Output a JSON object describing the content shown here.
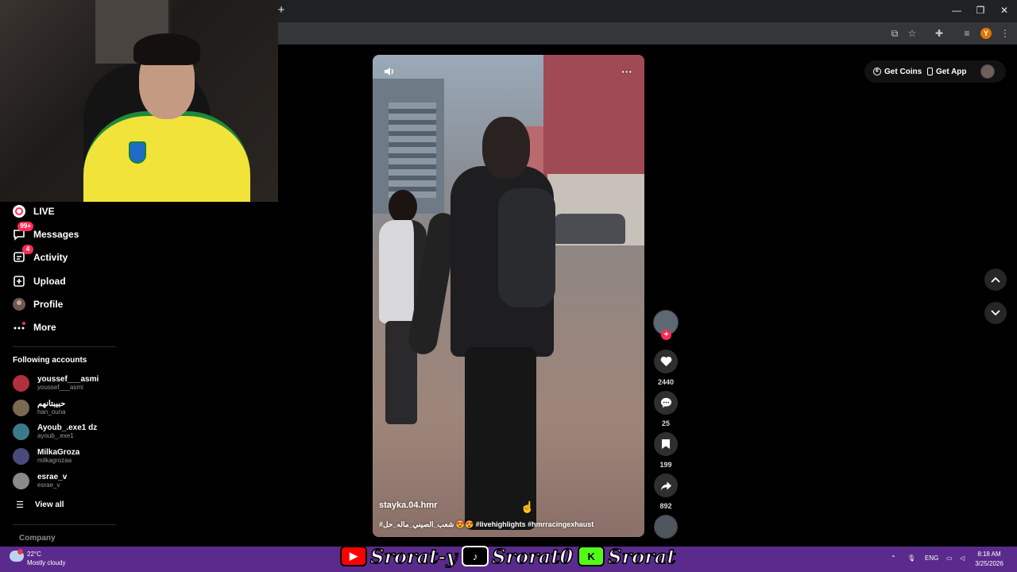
{
  "nav": {
    "live": "LIVE",
    "messages": "Messages",
    "messages_badge": "99+",
    "activity": "Activity",
    "activity_badge": "4",
    "upload": "Upload",
    "profile": "Profile",
    "more": "More"
  },
  "following": {
    "title": "Following accounts",
    "accounts": [
      {
        "name": "youssef___asmi",
        "handle": "youssef___asmi",
        "color": "#b03040"
      },
      {
        "name": "حبيبتانهم",
        "handle": "han_ouna",
        "color": "#7a6a50"
      },
      {
        "name": "Ayoub_.exe1 dz",
        "handle": "ayoub_.exe1",
        "color": "#3a7a8a"
      },
      {
        "name": "MilkaGroza",
        "handle": "milkagrozaa",
        "color": "#4a4a7a"
      },
      {
        "name": "esrae_v",
        "handle": "esrae_v",
        "color": "#8a8a8a"
      }
    ],
    "view_all": "View all"
  },
  "company": "Company",
  "top": {
    "get_coins": "Get Coins",
    "get_app": "Get App"
  },
  "video": {
    "username": "stayka.04.hmr",
    "caption": "#شعب_الصيني_ماله_حل 😍😍 #livehighlights #hmrracingexhaust"
  },
  "actions": {
    "likes": "2440",
    "comments": "25",
    "saves": "199",
    "shares": "892"
  },
  "taskbar": {
    "temp": "22°C",
    "condition": "Mostly cloudy",
    "lang": "ENG",
    "time": "8:18 AM",
    "date": "3/25/2026"
  },
  "overlay": {
    "brand1": "Srorat-y",
    "brand2": "Srorat0",
    "brand3": "Srorat",
    "youtube_color": "#ff0000",
    "tiktok_color": "#000000",
    "kick_color": "#53fc18"
  },
  "colors": {
    "accent": "#fe2c55",
    "taskbar": "#5a2b8c"
  }
}
